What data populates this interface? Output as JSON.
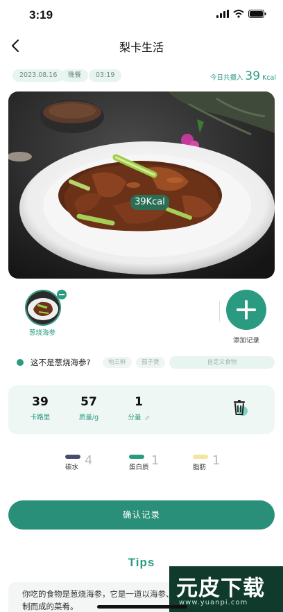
{
  "status": {
    "time": "3:19"
  },
  "nav": {
    "title": "梨卡生活"
  },
  "meta": {
    "date": "2023.08.16",
    "meal": "晚餐",
    "clock": "03:19",
    "today_label": "今日共摄入",
    "today_value": "39",
    "today_unit": "Kcal"
  },
  "photo": {
    "kcal_tag": "39Kcal"
  },
  "food": {
    "name": "葱烧海参"
  },
  "add": {
    "label": "添加记录"
  },
  "question": {
    "text": "这不是葱烧海参?",
    "alternatives": [
      "地三鲜",
      "茄子煲"
    ],
    "custom": "自定义食物"
  },
  "nutrition": {
    "calories": {
      "value": "39",
      "label": "卡路里"
    },
    "mass": {
      "value": "57",
      "label": "质量/g"
    },
    "portion": {
      "value": "1",
      "label": "分量"
    }
  },
  "macros": [
    {
      "label": "碳水",
      "value": "4",
      "color": "#4a4a6e"
    },
    {
      "label": "蛋白质",
      "value": "1",
      "color": "#2a9a80"
    },
    {
      "label": "脂肪",
      "value": "1",
      "color": "#f5e3a0"
    }
  ],
  "confirm": {
    "label": "确认记录"
  },
  "tips": {
    "title": "Tips",
    "text": "你吃的食物是葱烧海参，它是一道以海参、大葱、姜和其他调料烹制而成的菜肴。"
  },
  "watermark": {
    "logo": "元皮下载",
    "url": "www.yuanpi.com"
  },
  "colors": {
    "accent": "#2a9a80"
  }
}
